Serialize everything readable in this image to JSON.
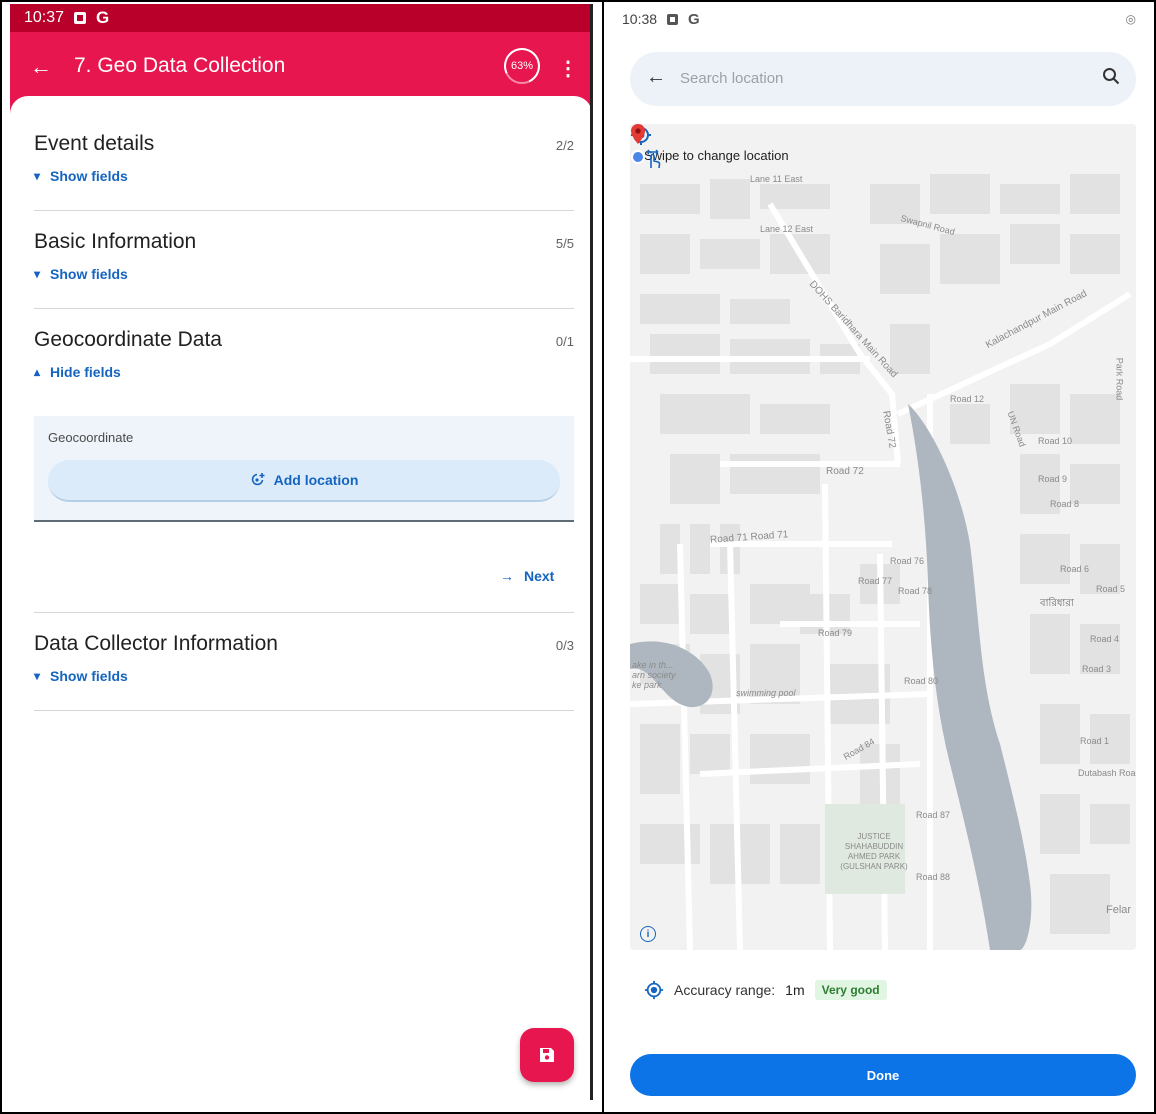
{
  "left": {
    "status_time": "10:37",
    "status_g": "G",
    "app_title": "7. Geo Data Collection",
    "progress": "63%",
    "sections": [
      {
        "title": "Event details",
        "count": "2/2",
        "toggle": "Show fields"
      },
      {
        "title": "Basic Information",
        "count": "5/5",
        "toggle": "Show fields"
      },
      {
        "title": "Geocoordinate Data",
        "count": "0/1",
        "toggle": "Hide fields"
      },
      {
        "title": "Data Collector Information",
        "count": "0/3",
        "toggle": "Show fields"
      }
    ],
    "geo_field_label": "Geocoordinate",
    "add_location": "Add location",
    "next": "Next",
    "accent_color": "#e8164f",
    "link_color": "#1565c0"
  },
  "right": {
    "status_time": "10:38",
    "status_g": "G",
    "search_placeholder": "Search location",
    "swipe_hint": "Swipe to change location",
    "map_labels": {
      "lane_11": "Lane 11 East",
      "lane_12": "Lane 12 East",
      "swapnil": "Swapnil Road",
      "dohs": "DOHS Baridhara Main Road",
      "kalachandpur": "Kalachandpur Main Road",
      "road72v": "Road 72",
      "road72h": "Road 72",
      "road71": "Road 71  Road 71",
      "road76": "Road 76",
      "road77": "Road 77",
      "road78": "Road 78",
      "road79": "Road 79",
      "swimming": "swimming pool",
      "road80": "Road 80",
      "road84": "Road 84",
      "road87": "Road 87",
      "road88": "Road 88",
      "park": "JUSTICE SHAHABUDDIN AHMED PARK (GULSHAN PARK)",
      "road12": "Road 12",
      "road10": "Road 10",
      "road9": "Road 9",
      "road8": "Road 8",
      "road6": "Road 6",
      "road5": "Road 5",
      "road4": "Road 4",
      "road3": "Road 3",
      "road1": "Road 1",
      "dutabash": "Dutabash Road",
      "bengali": "বারিধারা",
      "lake": "ake in th... arn society ke park",
      "felar": "Felar",
      "park_road": "Park Road",
      "un_road": "UN Road"
    },
    "accuracy_label": "Accuracy range:",
    "accuracy_value": "1m",
    "accuracy_quality": "Very good",
    "done": "Done",
    "primary_color": "#0d74e7"
  }
}
